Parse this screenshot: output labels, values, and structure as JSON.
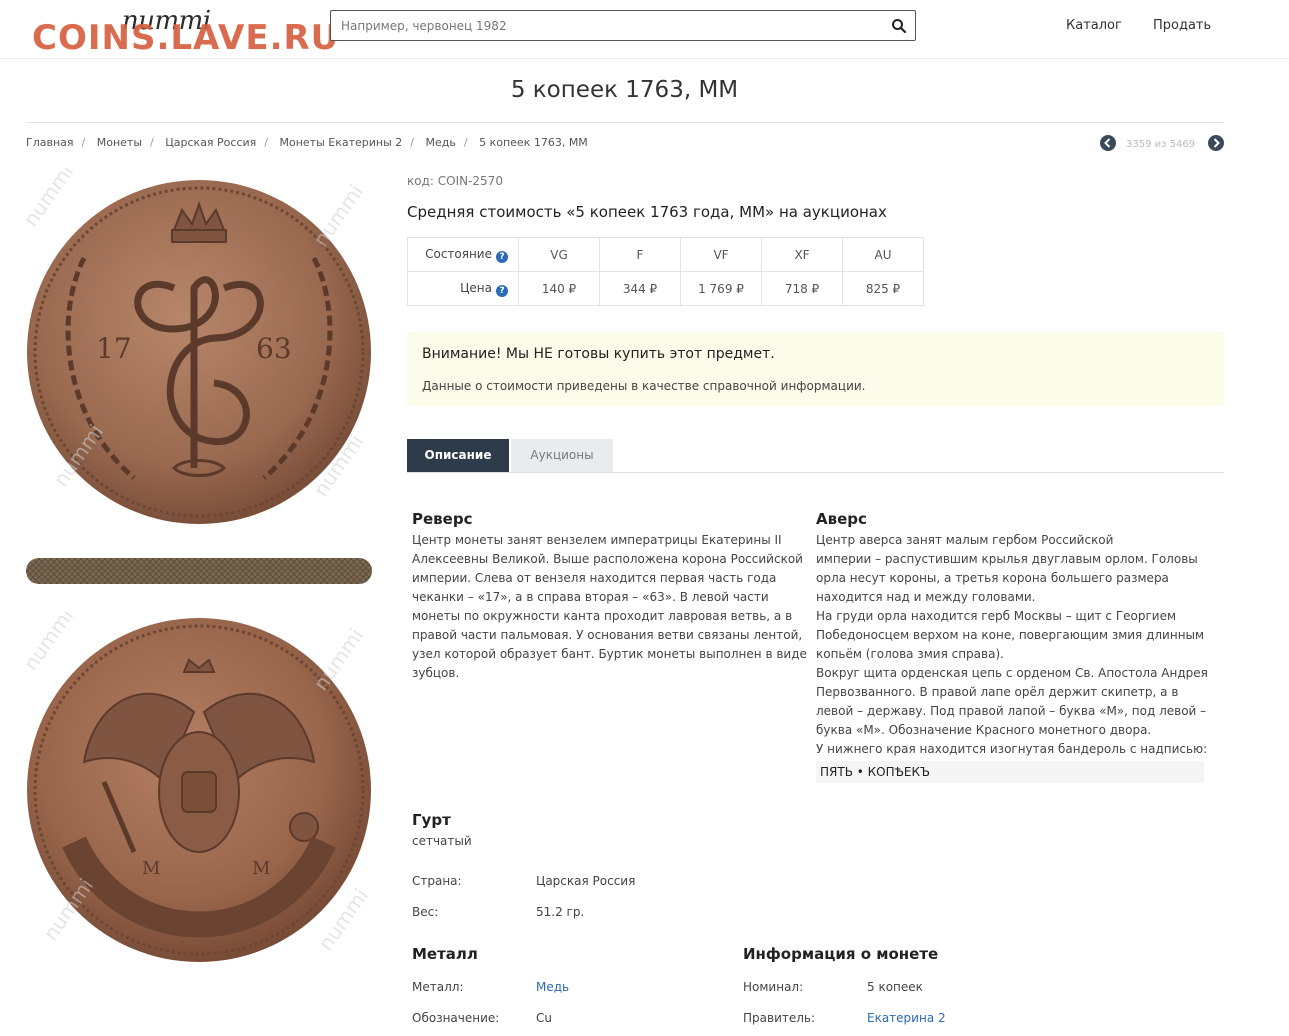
{
  "header": {
    "logo_text": "nummi",
    "watermark_text": "COINS.LAVE.RU",
    "search_placeholder": "Например, червонец 1982",
    "nav": [
      "Каталог",
      "Продать"
    ]
  },
  "page_title": "5 копеек 1763, ММ",
  "breadcrumb": [
    "Главная",
    "Монеты",
    "Царская Россия",
    "Монеты Екатерины 2",
    "Медь",
    "5 копеек 1763, ММ"
  ],
  "pager": {
    "text": "3359 из 5469"
  },
  "images": {
    "watermark": "nummi"
  },
  "coin": {
    "code": "код: COIN-2570",
    "price_title": "Средняя стоимость «5 копеек 1763 года, ММ» на аукционах",
    "prices": {
      "condition_label": "Состояние",
      "price_label": "Цена",
      "grades": [
        "VG",
        "F",
        "VF",
        "XF",
        "AU"
      ],
      "values": [
        "140 ₽",
        "344 ₽",
        "1 769 ₽",
        "718 ₽",
        "825 ₽"
      ]
    }
  },
  "notice": {
    "title": "Внимание! Мы НЕ готовы купить этот предмет.",
    "text": "Данные о стоимости приведены в качестве справочной информации."
  },
  "tabs": [
    "Описание",
    "Аукционы"
  ],
  "description": {
    "reverse": {
      "title": "Реверс",
      "lines": [
        "Центр монеты занят вензелем императрицы Екатерины II",
        "Алексеевны Великой. Выше расположена корона Российской",
        "империи. Слева от вензеля находится первая часть года",
        "чеканки – «17», а в справа вторая – «63». В левой части",
        "монеты по окружности канта проходит лавровая ветвь, а в",
        "правой части пальмовая. У основания ветви связаны лентой,",
        "узел которой образует бант. Буртик монеты выполнен в виде",
        "зубцов."
      ]
    },
    "obverse": {
      "title": "Аверс",
      "lines": [
        "Центр аверса занят малым гербом Российской",
        "империи – распустившим крылья двуглавым орлом. Головы",
        "орла несут короны, а третья корона большего размера",
        "находится над и между головами.",
        "На груди орла находится герб Москвы – щит с Георгием",
        "Победоносцем верхом на коне, повергающим змия длинным",
        "копьём (голова змия справа).",
        "Вокруг щита орденская цепь с орденом Св. Апостола Андрея",
        "Первозванного. В правой лапе орёл держит скипетр, а в",
        "левой – державу. Под правой лапой – буква «М», под левой –",
        "буква «М». Обозначение Красного монетного двора.",
        "У нижнего края находится изогнутая бандероль с надписью:"
      ],
      "inscription": "ПЯТЬ • КОПѢЕКЪ"
    },
    "edge": {
      "title": "Гурт",
      "value": "сетчатый"
    },
    "country_label": "Страна:",
    "country": "Царская Россия",
    "weight_label": "Вес:",
    "weight": "51.2 гр.",
    "metal": {
      "title": "Металл",
      "metal_label": "Металл:",
      "metal_value": "Медь",
      "designation_label": "Обозначение:",
      "designation_value": "Cu"
    },
    "info": {
      "title": "Информация о монете",
      "nominal_label": "Номинал:",
      "nominal_value": "5 копеек",
      "ruler_label": "Правитель:",
      "ruler_value": "Екатерина 2"
    }
  }
}
